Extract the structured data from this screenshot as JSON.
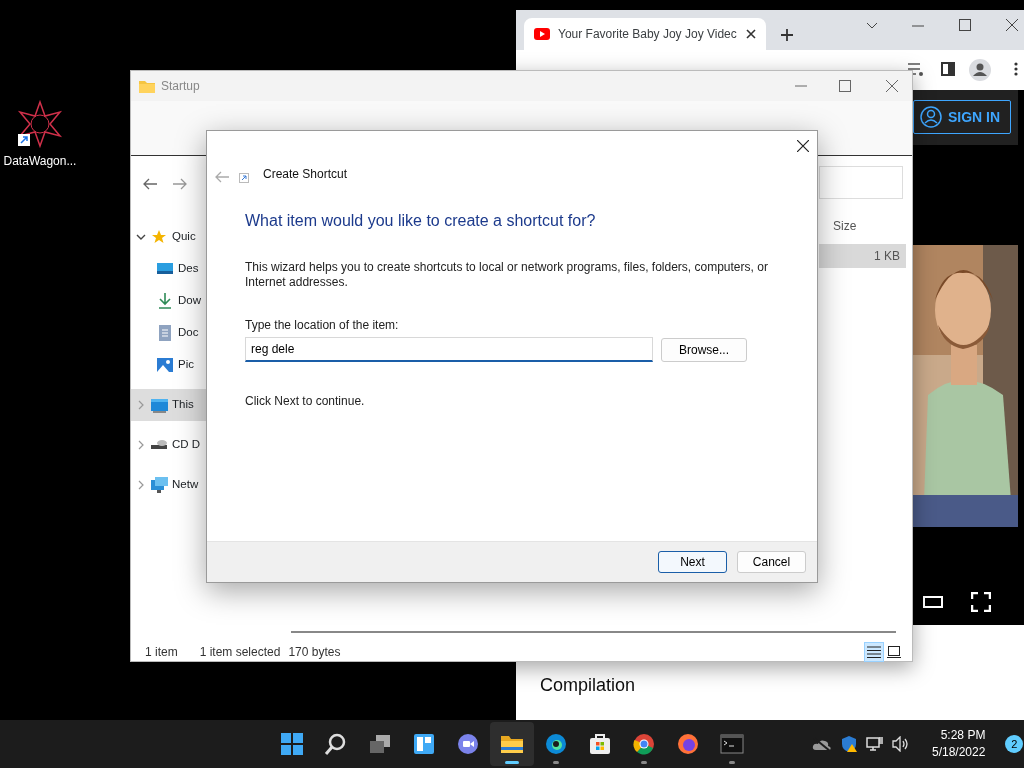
{
  "desktop": {
    "icons": [
      {
        "label": "DataWagon..."
      }
    ]
  },
  "browser": {
    "tab": {
      "title": "Your Favorite Baby Joy Joy Videc"
    },
    "sign_in": "SIGN IN",
    "video_title": "Compilation"
  },
  "explorer": {
    "title": "Startup",
    "sidebar": [
      {
        "label": "Quic",
        "expanded": true,
        "selected": false,
        "children": [
          {
            "label": "Des",
            "selected": false
          },
          {
            "label": "Dow",
            "selected": false
          },
          {
            "label": "Doc",
            "selected": false
          },
          {
            "label": "Pic",
            "selected": false
          }
        ]
      },
      {
        "label": "This",
        "expanded": false,
        "selected": true
      },
      {
        "label": "CD D",
        "expanded": false,
        "selected": false
      },
      {
        "label": "Netw",
        "expanded": false,
        "selected": false
      }
    ],
    "columns": [
      "Size"
    ],
    "rows": [
      {
        "size": "1 KB",
        "selected": true
      }
    ],
    "status": {
      "count": "1 item",
      "selection": "1 item selected",
      "size": "170 bytes"
    },
    "views": [
      {
        "selected": true
      },
      {
        "selected": false
      }
    ]
  },
  "dialog": {
    "window_title": "Create Shortcut",
    "heading": "What item would you like to create a shortcut for?",
    "description": "This wizard helps you to create shortcuts to local or network programs, files, folders, computers, or Internet addresses.",
    "field_label": "Type the location of the item:",
    "field_value": "reg dele",
    "browse": "Browse...",
    "hint": "Click Next to continue.",
    "buttons": [
      {
        "label": "Next",
        "default": true
      },
      {
        "label": "Cancel",
        "default": false
      }
    ]
  },
  "taskbar": {
    "apps": [
      {
        "running": false,
        "selected": false
      },
      {
        "running": false,
        "selected": false
      },
      {
        "running": false,
        "selected": false
      },
      {
        "running": false,
        "selected": false
      },
      {
        "running": false,
        "selected": false
      },
      {
        "running": true,
        "selected": true
      },
      {
        "running": true,
        "selected": false
      },
      {
        "running": false,
        "selected": false
      },
      {
        "running": true,
        "selected": false
      },
      {
        "running": false,
        "selected": false
      },
      {
        "running": true,
        "selected": false
      }
    ],
    "time": "5:28 PM",
    "date": "5/18/2022",
    "notifications": "2"
  }
}
